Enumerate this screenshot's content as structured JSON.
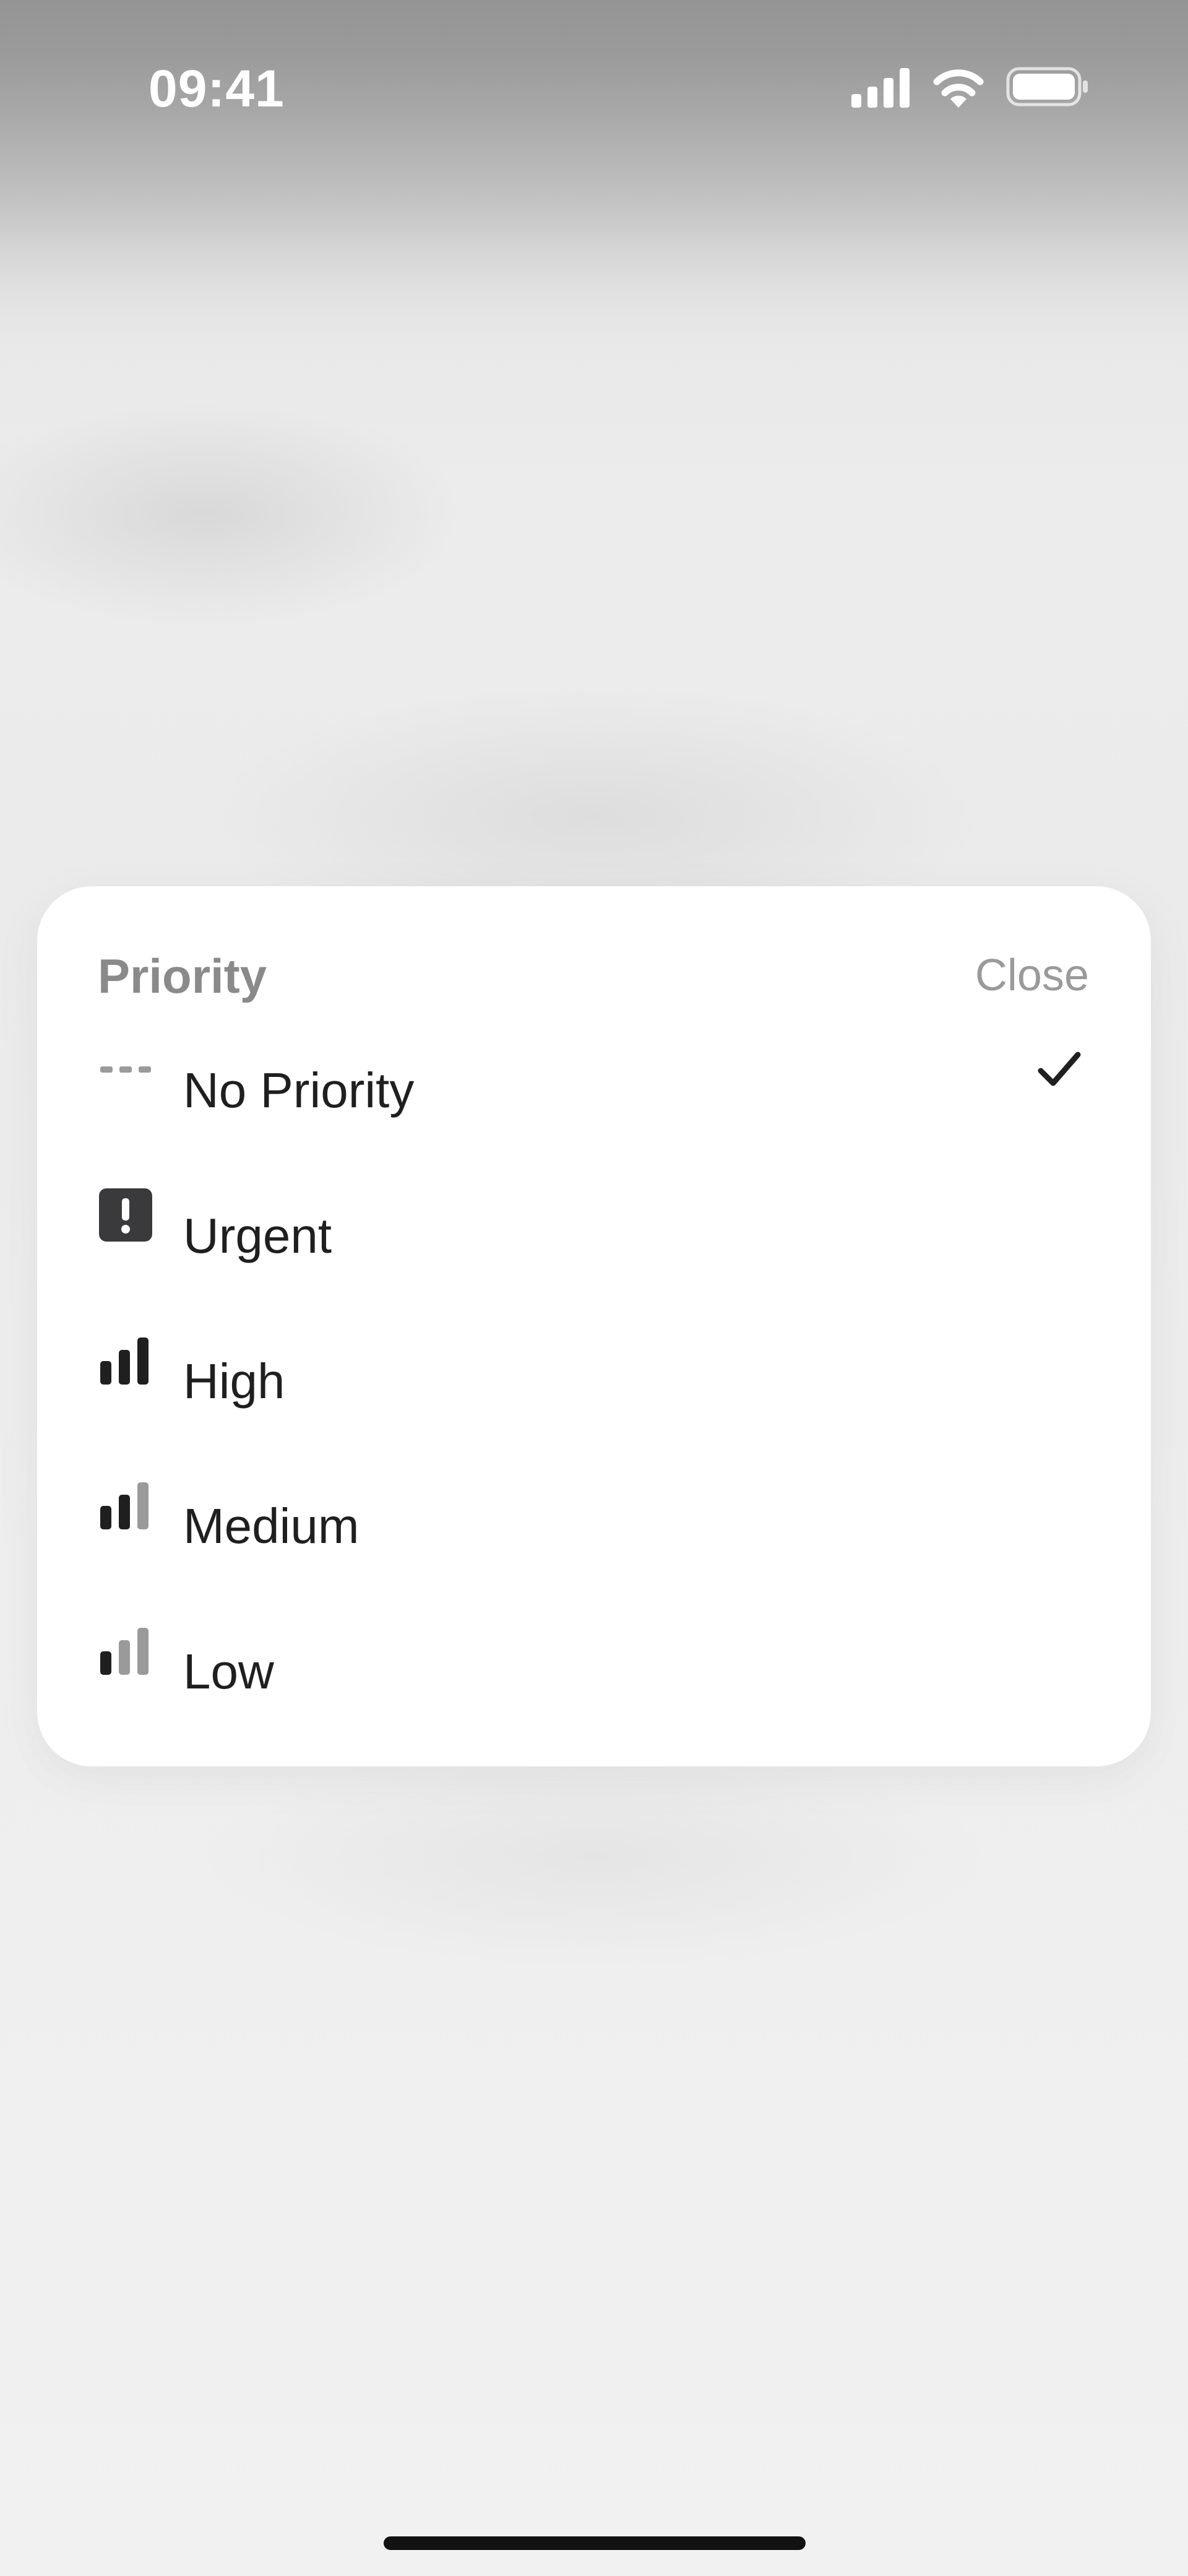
{
  "status_bar": {
    "time": "09:41",
    "icons": [
      "signal-icon",
      "wifi-icon",
      "battery-icon"
    ]
  },
  "sheet": {
    "title": "Priority",
    "close_label": "Close",
    "options": [
      {
        "label": "No Priority",
        "icon": "no-priority-dashes-icon",
        "selected": true
      },
      {
        "label": "Urgent",
        "icon": "urgent-exclamation-icon",
        "selected": false
      },
      {
        "label": "High",
        "icon": "priority-bars-high-icon",
        "selected": false
      },
      {
        "label": "Medium",
        "icon": "priority-bars-medium-icon",
        "selected": false
      },
      {
        "label": "Low",
        "icon": "priority-bars-low-icon",
        "selected": false
      }
    ]
  },
  "colors": {
    "active_bar": "#1f1f1f",
    "inactive_bar": "#9a9a9a",
    "header_text": "#8a8a8a",
    "sheet_background": "#ffffff"
  }
}
